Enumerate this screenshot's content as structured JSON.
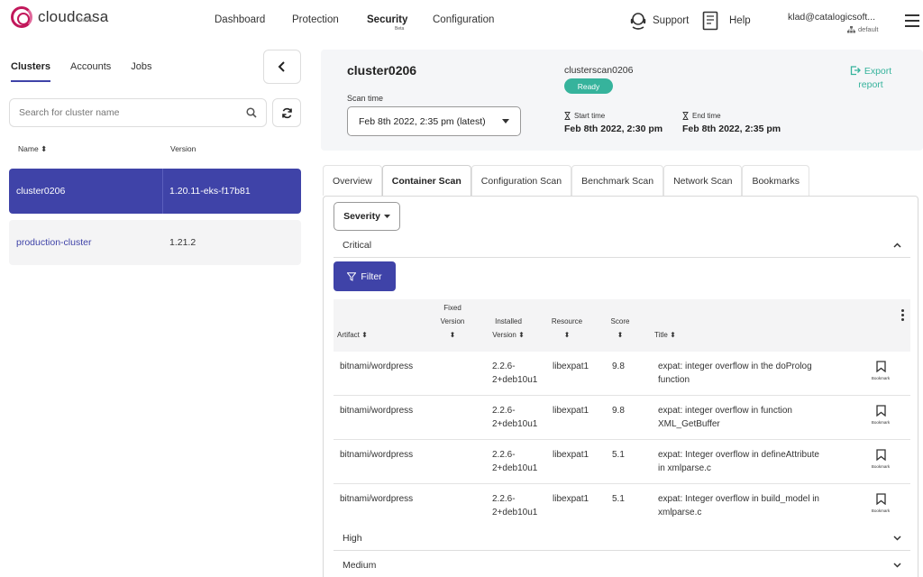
{
  "brand": {
    "name": "cloudcasa",
    "edition": "Starter"
  },
  "nav": {
    "items": [
      {
        "label": "Dashboard"
      },
      {
        "label": "Protection"
      },
      {
        "label": "Security",
        "active": true,
        "badge": "Beta"
      },
      {
        "label": "Configuration"
      }
    ],
    "support_label": "Support",
    "help_label": "Help",
    "user_email": "klad@catalogicsoft...",
    "user_org": "default"
  },
  "left": {
    "tabs": [
      {
        "label": "Clusters",
        "active": true
      },
      {
        "label": "Accounts"
      },
      {
        "label": "Jobs"
      }
    ],
    "search_placeholder": "Search for cluster name",
    "columns": {
      "name": "Name",
      "version": "Version"
    },
    "clusters": [
      {
        "name": "cluster0206",
        "version": "1.20.11-eks-f17b81",
        "selected": true
      },
      {
        "name": "production-cluster",
        "version": "1.21.2",
        "selected": false
      }
    ]
  },
  "scan": {
    "cluster_name": "cluster0206",
    "scan_time_label": "Scan time",
    "scan_time_value": "Feb 8th 2022, 2:35 pm (latest)",
    "scan_name": "clusterscan0206",
    "status": "Ready",
    "start_label": "Start time",
    "start_value": "Feb 8th 2022, 2:30 pm",
    "end_label": "End time",
    "end_value": "Feb 8th 2022, 2:35 pm",
    "export_line1": "Export",
    "export_line2": "report"
  },
  "tabs": [
    {
      "label": "Overview"
    },
    {
      "label": "Container Scan",
      "active": true
    },
    {
      "label": "Configuration Scan"
    },
    {
      "label": "Benchmark Scan"
    },
    {
      "label": "Network Scan"
    },
    {
      "label": "Bookmarks"
    }
  ],
  "container_scan": {
    "severity_label": "Severity",
    "groups": {
      "critical": "Critical",
      "high": "High",
      "medium": "Medium"
    },
    "filter_label": "Filter",
    "columns": {
      "artifact": "Artifact",
      "fixed_version_1": "Fixed",
      "fixed_version_2": "Version",
      "installed_1": "Installed",
      "installed_2": "Version",
      "resource": "Resource",
      "score": "Score",
      "title": "Title"
    },
    "bookmark_label": "Bookmark",
    "rows": [
      {
        "artifact": "bitnami/wordpress",
        "fixed": "",
        "installed_1": "2.2.6-",
        "installed_2": "2+deb10u1",
        "resource": "libexpat1",
        "score": "9.8",
        "title_1": "expat: integer overflow in the doProlog",
        "title_2": "function"
      },
      {
        "artifact": "bitnami/wordpress",
        "fixed": "",
        "installed_1": "2.2.6-",
        "installed_2": "2+deb10u1",
        "resource": "libexpat1",
        "score": "9.8",
        "title_1": "expat: integer overflow in function",
        "title_2": "XML_GetBuffer"
      },
      {
        "artifact": "bitnami/wordpress",
        "fixed": "",
        "installed_1": "2.2.6-",
        "installed_2": "2+deb10u1",
        "resource": "libexpat1",
        "score": "5.1",
        "title_1": "expat: Integer overflow in defineAttribute",
        "title_2": "in xmlparse.c"
      },
      {
        "artifact": "bitnami/wordpress",
        "fixed": "",
        "installed_1": "2.2.6-",
        "installed_2": "2+deb10u1",
        "resource": "libexpat1",
        "score": "5.1",
        "title_1": "expat: Integer overflow in build_model in",
        "title_2": "xmlparse.c"
      }
    ]
  },
  "colors": {
    "primary": "#3f43a8",
    "accent": "#36b39c",
    "brand": "#c2185b"
  }
}
